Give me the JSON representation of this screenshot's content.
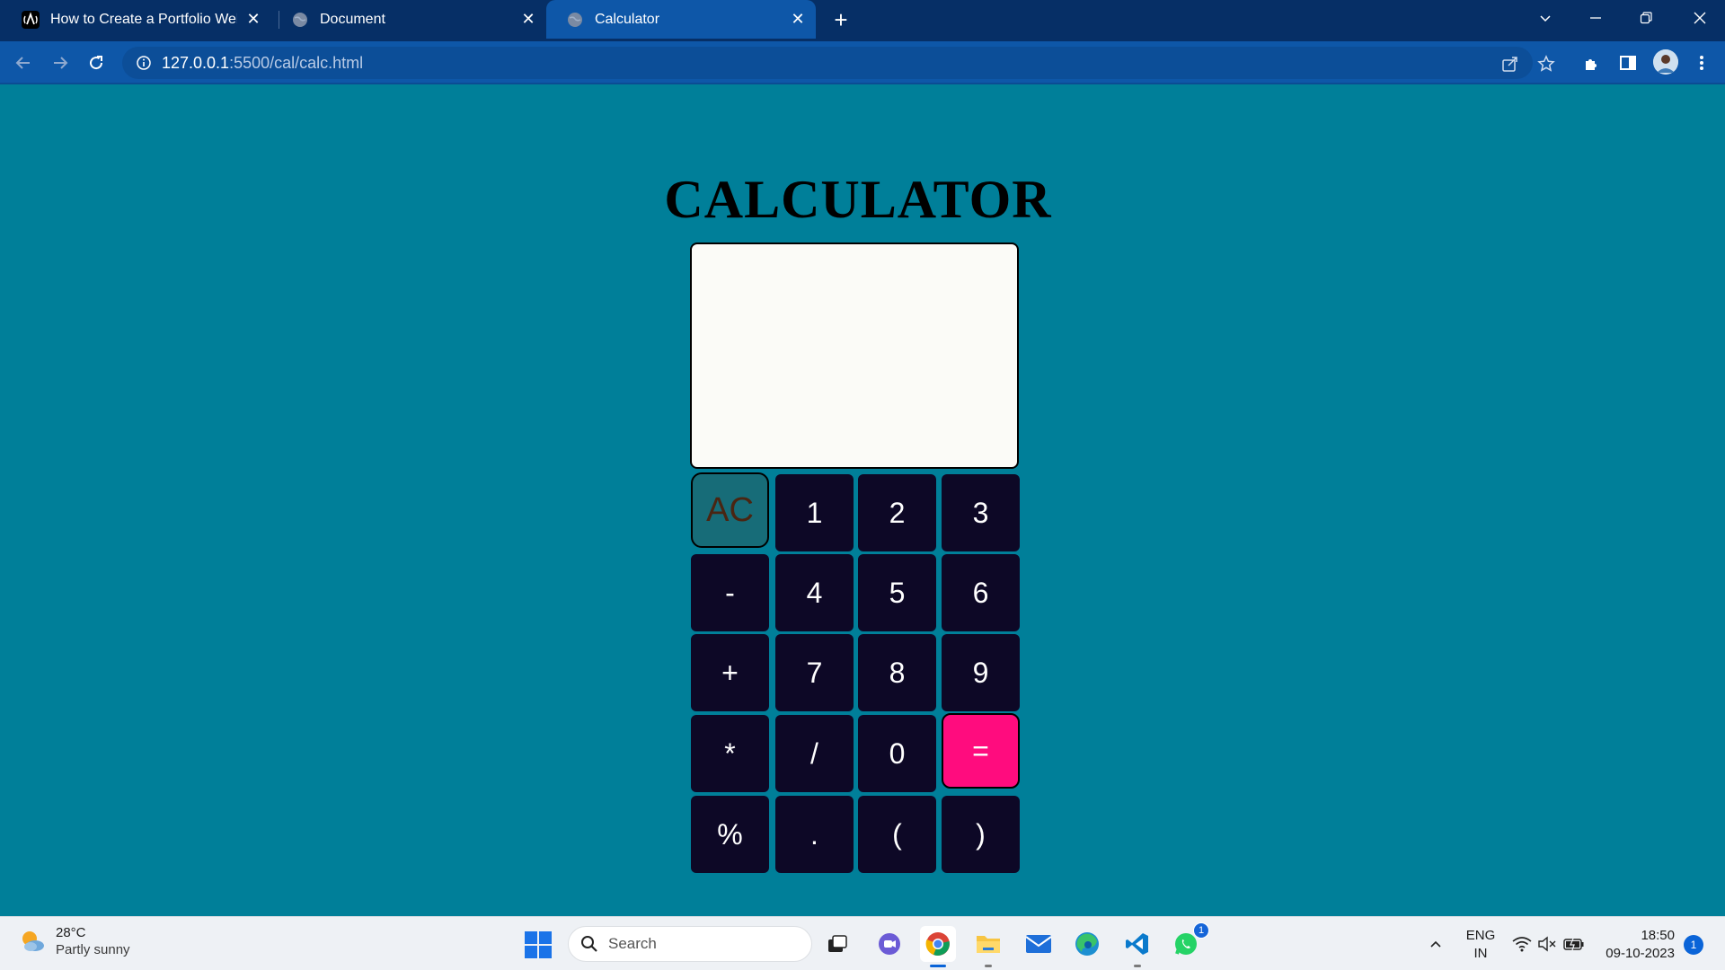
{
  "browser": {
    "tabs": [
      {
        "title": "How to Create a Portfolio Websi",
        "favicon": "astro-logo-icon",
        "active": false
      },
      {
        "title": "Document",
        "favicon": "globe-icon",
        "active": false
      },
      {
        "title": "Calculator",
        "favicon": "globe-icon",
        "active": true
      }
    ],
    "url_host": "127.0.0.1",
    "url_path": ":5500/cal/calc.html",
    "colors": {
      "tabstrip": "#062f66",
      "toolbar": "#0e57a8"
    }
  },
  "page": {
    "title": "CALCULATOR",
    "display_value": "",
    "background": "#007f99",
    "keys": [
      [
        "AC",
        "1",
        "2",
        "3"
      ],
      [
        "-",
        "4",
        "5",
        "6"
      ],
      [
        "+",
        "7",
        "8",
        "9"
      ],
      [
        "*",
        "/",
        "0",
        "="
      ],
      [
        "%",
        ".",
        "(",
        ")"
      ]
    ],
    "key_colors": {
      "default": "#0d0826",
      "clear": "#176c78",
      "equals": "#ff0c7e"
    }
  },
  "taskbar": {
    "weather_temp": "28°C",
    "weather_desc": "Partly sunny",
    "search_placeholder": "Search",
    "whatsapp_badge": "1",
    "lang_line1": "ENG",
    "lang_line2": "IN",
    "time": "18:50",
    "date": "09-10-2023",
    "notification_count": "1"
  }
}
